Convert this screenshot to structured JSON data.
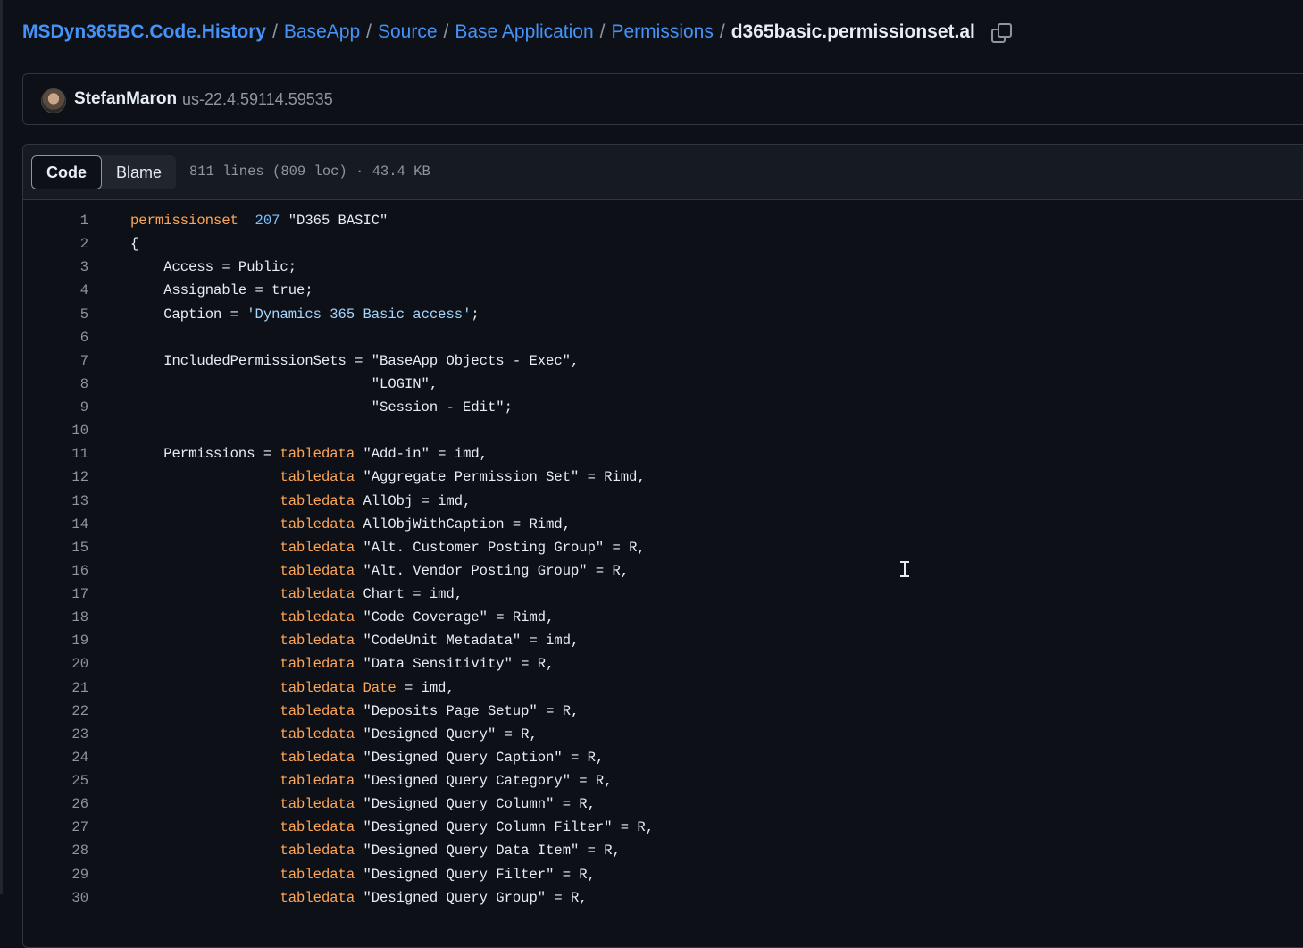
{
  "breadcrumb": {
    "repo": "MSDyn365BC.Code.History",
    "parts": [
      "BaseApp",
      "Source",
      "Base Application",
      "Permissions"
    ],
    "separator": "/",
    "file": "d365basic.permissionset.al",
    "copy_icon": "copy-icon"
  },
  "commit": {
    "author": "StefanMaron",
    "ref": "us-22.4.59114.59535"
  },
  "file_header": {
    "code_tab": "Code",
    "blame_tab": "Blame",
    "info": "811 lines (809 loc) · 43.4 KB"
  },
  "colors": {
    "background": "#0d1117",
    "link": "#4493f8",
    "keyword": "#ffa657",
    "number": "#79c0ff",
    "string": "#a5d6ff"
  },
  "code_lines": [
    {
      "n": "1",
      "segs": [
        [
          "kw",
          "permissionset"
        ],
        [
          "",
          "  "
        ],
        [
          "num",
          "207"
        ],
        [
          "",
          " \"D365 BASIC\""
        ]
      ]
    },
    {
      "n": "2",
      "segs": [
        [
          "",
          "{"
        ]
      ]
    },
    {
      "n": "3",
      "segs": [
        [
          "",
          "    Access = Public;"
        ]
      ]
    },
    {
      "n": "4",
      "segs": [
        [
          "",
          "    Assignable = true;"
        ]
      ]
    },
    {
      "n": "5",
      "segs": [
        [
          "",
          "    Caption = "
        ],
        [
          "str",
          "'Dynamics 365 Basic access'"
        ],
        [
          "",
          ";"
        ]
      ]
    },
    {
      "n": "6",
      "segs": []
    },
    {
      "n": "7",
      "segs": [
        [
          "",
          "    IncludedPermissionSets = \"BaseApp Objects - Exec\","
        ]
      ]
    },
    {
      "n": "8",
      "segs": [
        [
          "",
          "                             \"LOGIN\","
        ]
      ]
    },
    {
      "n": "9",
      "segs": [
        [
          "",
          "                             \"Session - Edit\";"
        ]
      ]
    },
    {
      "n": "10",
      "segs": []
    },
    {
      "n": "11",
      "segs": [
        [
          "",
          "    Permissions = "
        ],
        [
          "kw",
          "tabledata"
        ],
        [
          "",
          " \"Add-in\" = imd,"
        ]
      ]
    },
    {
      "n": "12",
      "segs": [
        [
          "",
          "                  "
        ],
        [
          "kw",
          "tabledata"
        ],
        [
          "",
          " \"Aggregate Permission Set\" = Rimd,"
        ]
      ]
    },
    {
      "n": "13",
      "segs": [
        [
          "",
          "                  "
        ],
        [
          "kw",
          "tabledata"
        ],
        [
          "",
          " AllObj = imd,"
        ]
      ]
    },
    {
      "n": "14",
      "segs": [
        [
          "",
          "                  "
        ],
        [
          "kw",
          "tabledata"
        ],
        [
          "",
          " AllObjWithCaption = Rimd,"
        ]
      ]
    },
    {
      "n": "15",
      "segs": [
        [
          "",
          "                  "
        ],
        [
          "kw",
          "tabledata"
        ],
        [
          "",
          " \"Alt. Customer Posting Group\" = R,"
        ]
      ]
    },
    {
      "n": "16",
      "segs": [
        [
          "",
          "                  "
        ],
        [
          "kw",
          "tabledata"
        ],
        [
          "",
          " \"Alt. Vendor Posting Group\" = R,"
        ]
      ]
    },
    {
      "n": "17",
      "segs": [
        [
          "",
          "                  "
        ],
        [
          "kw",
          "tabledata"
        ],
        [
          "",
          " Chart = imd,"
        ]
      ]
    },
    {
      "n": "18",
      "segs": [
        [
          "",
          "                  "
        ],
        [
          "kw",
          "tabledata"
        ],
        [
          "",
          " \"Code Coverage\" = Rimd,"
        ]
      ]
    },
    {
      "n": "19",
      "segs": [
        [
          "",
          "                  "
        ],
        [
          "kw",
          "tabledata"
        ],
        [
          "",
          " \"CodeUnit Metadata\" = imd,"
        ]
      ]
    },
    {
      "n": "20",
      "segs": [
        [
          "",
          "                  "
        ],
        [
          "kw",
          "tabledata"
        ],
        [
          "",
          " \"Data Sensitivity\" = R,"
        ]
      ]
    },
    {
      "n": "21",
      "segs": [
        [
          "",
          "                  "
        ],
        [
          "kw",
          "tabledata"
        ],
        [
          "",
          ""
        ],
        [
          "kw",
          " Date"
        ],
        [
          "",
          " = imd,"
        ]
      ]
    },
    {
      "n": "22",
      "segs": [
        [
          "",
          "                  "
        ],
        [
          "kw",
          "tabledata"
        ],
        [
          "",
          " \"Deposits Page Setup\" = R,"
        ]
      ]
    },
    {
      "n": "23",
      "segs": [
        [
          "",
          "                  "
        ],
        [
          "kw",
          "tabledata"
        ],
        [
          "",
          " \"Designed Query\" = R,"
        ]
      ]
    },
    {
      "n": "24",
      "segs": [
        [
          "",
          "                  "
        ],
        [
          "kw",
          "tabledata"
        ],
        [
          "",
          " \"Designed Query Caption\" = R,"
        ]
      ]
    },
    {
      "n": "25",
      "segs": [
        [
          "",
          "                  "
        ],
        [
          "kw",
          "tabledata"
        ],
        [
          "",
          " \"Designed Query Category\" = R,"
        ]
      ]
    },
    {
      "n": "26",
      "segs": [
        [
          "",
          "                  "
        ],
        [
          "kw",
          "tabledata"
        ],
        [
          "",
          " \"Designed Query Column\" = R,"
        ]
      ]
    },
    {
      "n": "27",
      "segs": [
        [
          "",
          "                  "
        ],
        [
          "kw",
          "tabledata"
        ],
        [
          "",
          " \"Designed Query Column Filter\" = R,"
        ]
      ]
    },
    {
      "n": "28",
      "segs": [
        [
          "",
          "                  "
        ],
        [
          "kw",
          "tabledata"
        ],
        [
          "",
          " \"Designed Query Data Item\" = R,"
        ]
      ]
    },
    {
      "n": "29",
      "segs": [
        [
          "",
          "                  "
        ],
        [
          "kw",
          "tabledata"
        ],
        [
          "",
          " \"Designed Query Filter\" = R,"
        ]
      ]
    },
    {
      "n": "30",
      "segs": [
        [
          "",
          "                  "
        ],
        [
          "kw",
          "tabledata"
        ],
        [
          "",
          " \"Designed Query Group\" = R,"
        ]
      ]
    }
  ]
}
